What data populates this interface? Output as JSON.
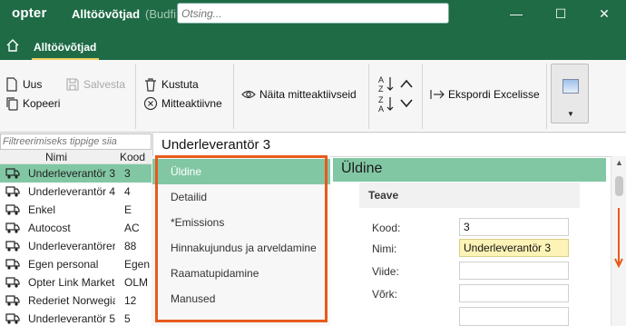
{
  "titlebar": {
    "logo": "opter",
    "title": "Alltöövõtjad",
    "subtitle": "(Budfi",
    "search_placeholder": "Otsing...",
    "minimize": "—",
    "maximize": "☐",
    "close": "✕"
  },
  "nav": {
    "tab": "Alltöövõtjad"
  },
  "toolbar": {
    "new": "Uus",
    "save": "Salvesta",
    "copy": "Kopeeri",
    "delete": "Kustuta",
    "inactive": "Mitteaktiivne",
    "show_inactive": "Näita mitteaktiivseid",
    "export": "Ekspordi Excelisse"
  },
  "list": {
    "filter_placeholder": "Filtreerimiseks tippige siia",
    "col_name": "Nimi",
    "col_code": "Kood",
    "rows": [
      {
        "name": "Underleverantör 3",
        "code": "3"
      },
      {
        "name": "Underleverantör 4",
        "code": "4"
      },
      {
        "name": "Enkel",
        "code": "E"
      },
      {
        "name": "Autocost",
        "code": "AC"
      },
      {
        "name": "Underleverantörer",
        "code": "88"
      },
      {
        "name": "Egen personal",
        "code": "Egen"
      },
      {
        "name": "Opter Link Market",
        "code": "OLM"
      },
      {
        "name": "Rederiet Norwegia",
        "code": "12"
      },
      {
        "name": "Underleverantör 5",
        "code": "5"
      }
    ],
    "selected_index": 0
  },
  "detail": {
    "title": "Underleverantör 3",
    "tabs": [
      "Üldine",
      "Detailid",
      "*Emissions",
      "Hinnakujundus ja arveldamine",
      "Raamatupidamine",
      "Manused"
    ],
    "active_tab": 0,
    "section_title": "Üldine",
    "group_title": "Teave",
    "fields": [
      {
        "label": "Kood:",
        "value": "3"
      },
      {
        "label": "Nimi:",
        "value": "Underleverantör 3"
      },
      {
        "label": "Viide:",
        "value": ""
      },
      {
        "label": "Võrk:",
        "value": ""
      }
    ]
  },
  "colors": {
    "brand_green": "#1e6b46",
    "selection_green": "#82c7a4",
    "highlight_orange": "#e85a1b",
    "field_highlight": "#fdf3b6"
  }
}
